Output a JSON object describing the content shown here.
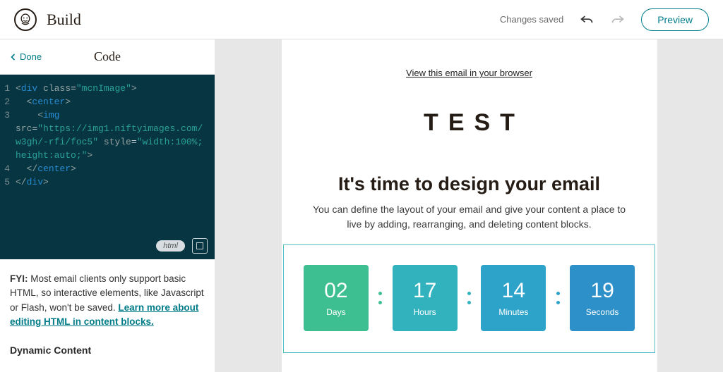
{
  "header": {
    "title": "Build",
    "status": "Changes saved",
    "preview_label": "Preview"
  },
  "panel": {
    "done_label": "Done",
    "title": "Code",
    "language_chip": "html",
    "code": {
      "line1_open": "div",
      "line1_attr": "class",
      "line1_val": "\"mcnImage\"",
      "line2": "center",
      "line3": "img",
      "line3_src_attr": "src",
      "line3_src_val": "\"https://img1.niftyimages.com/w3gh/-rfi/foc5\"",
      "line3_style_attr": "style",
      "line3_style_val": "\"width:100%;height:auto;\"",
      "line4": "center",
      "line5": "div"
    },
    "fyi_label": "FYI:",
    "fyi_text": " Most email clients only support basic HTML, so interactive elements, like Javascript or Flash, won't be saved. ",
    "fyi_link": "Learn more about editing HTML in content blocks.",
    "dynamic_title": "Dynamic Content"
  },
  "email": {
    "view_in_browser": "View this email in your browser",
    "logo": "TEST",
    "headline": "It's time to design your email",
    "body": "You can define the layout of your email and give your content a place to live by adding, rearranging, and deleting content blocks.",
    "countdown": [
      {
        "value": "02",
        "label": "Days",
        "color": "#3dbf91",
        "sep_color": "#3dbf91"
      },
      {
        "value": "17",
        "label": "Hours",
        "color": "#31b2bd",
        "sep_color": "#31b2bd"
      },
      {
        "value": "14",
        "label": "Minutes",
        "color": "#2ea3c9",
        "sep_color": "#2ea3c9"
      },
      {
        "value": "19",
        "label": "Seconds",
        "color": "#2d90c8",
        "sep_color": "#2d90c8"
      }
    ]
  }
}
